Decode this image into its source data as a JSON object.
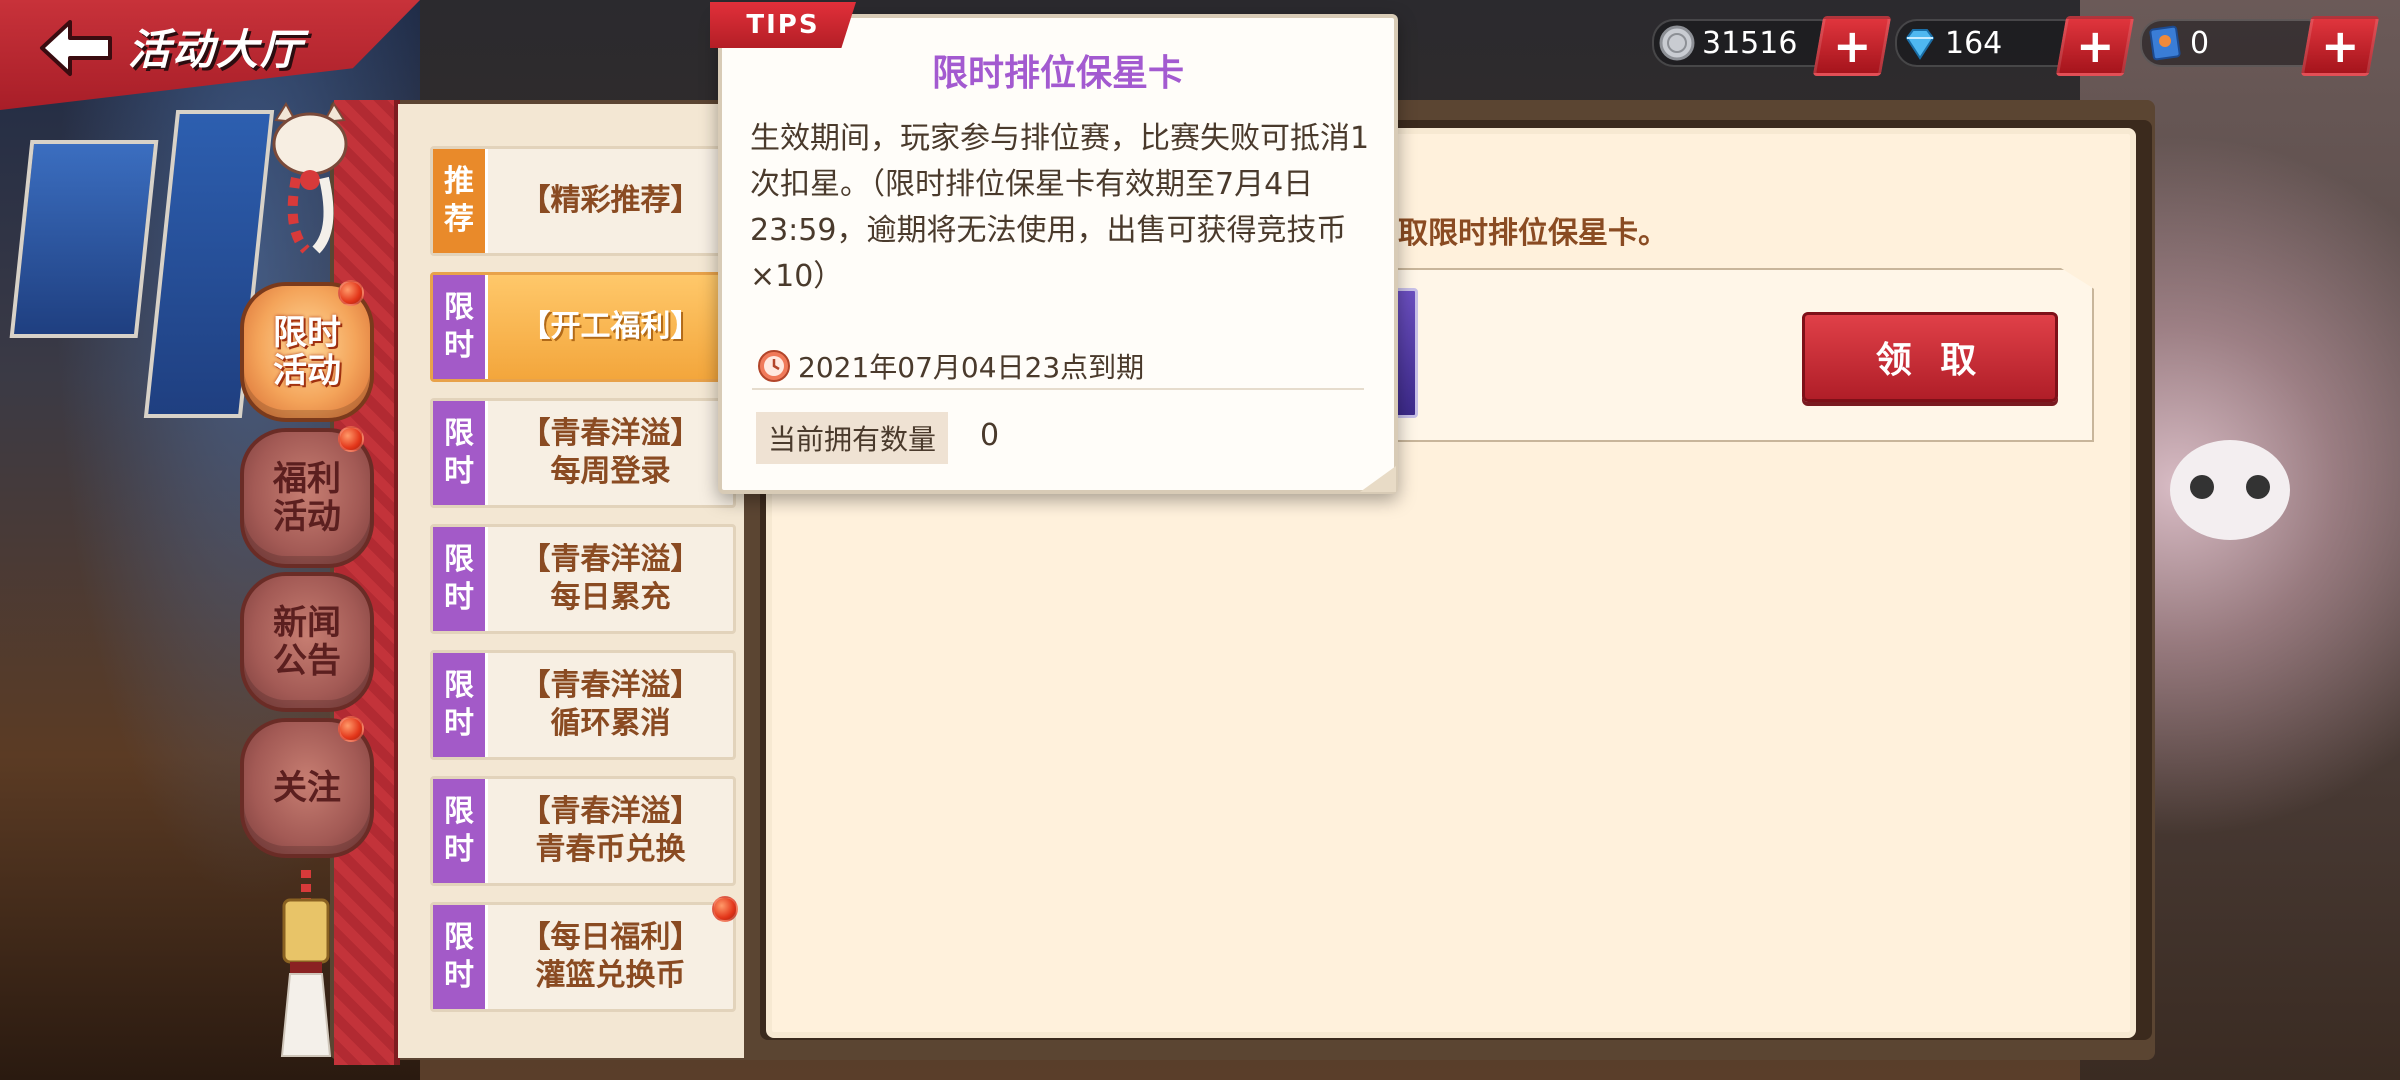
{
  "header": {
    "title": "活动大厅"
  },
  "currencies": [
    {
      "icon": "silver-coin-icon",
      "value": "31516"
    },
    {
      "icon": "diamond-icon",
      "value": "164"
    },
    {
      "icon": "ticket-card-icon",
      "value": "0"
    }
  ],
  "categories": [
    {
      "label": "限时\n活动",
      "active": true,
      "badge": true
    },
    {
      "label": "福利\n活动",
      "active": false,
      "badge": true
    },
    {
      "label": "新闻\n公告",
      "active": false,
      "badge": false
    },
    {
      "label": "关注",
      "active": false,
      "badge": true
    }
  ],
  "events": [
    {
      "tag": "推荐",
      "label": "【精彩推荐】"
    },
    {
      "tag": "限时",
      "label": "【开工福利】"
    },
    {
      "tag": "限时",
      "label": "【青春洋溢】\n每周登录"
    },
    {
      "tag": "限时",
      "label": "【青春洋溢】\n每日累充"
    },
    {
      "tag": "限时",
      "label": "【青春洋溢】\n循环累消"
    },
    {
      "tag": "限时",
      "label": "【青春洋溢】\n青春币兑换"
    },
    {
      "tag": "限时",
      "label": "【每日福利】\n灌篮兑换币"
    }
  ],
  "content": {
    "description_visible": "取限时排位保星卡。",
    "claim_button": "领 取"
  },
  "tips": {
    "tag": "TIPS",
    "title": "限时排位保星卡",
    "body": "生效期间，玩家参与排位赛，比赛失败可抵消1次扣星。（限时排位保星卡有效期至7月4日23:59，逾期将无法使用，出售可获得竞技币×10）",
    "expire": "2021年07月04日23点到期",
    "count_label": "当前拥有数量",
    "count_value": "0"
  },
  "colors": {
    "accent_red": "#c8323a",
    "tag_purple": "#a35ac8",
    "tag_orange": "#e98a2a",
    "tips_title": "#a35ad0"
  }
}
